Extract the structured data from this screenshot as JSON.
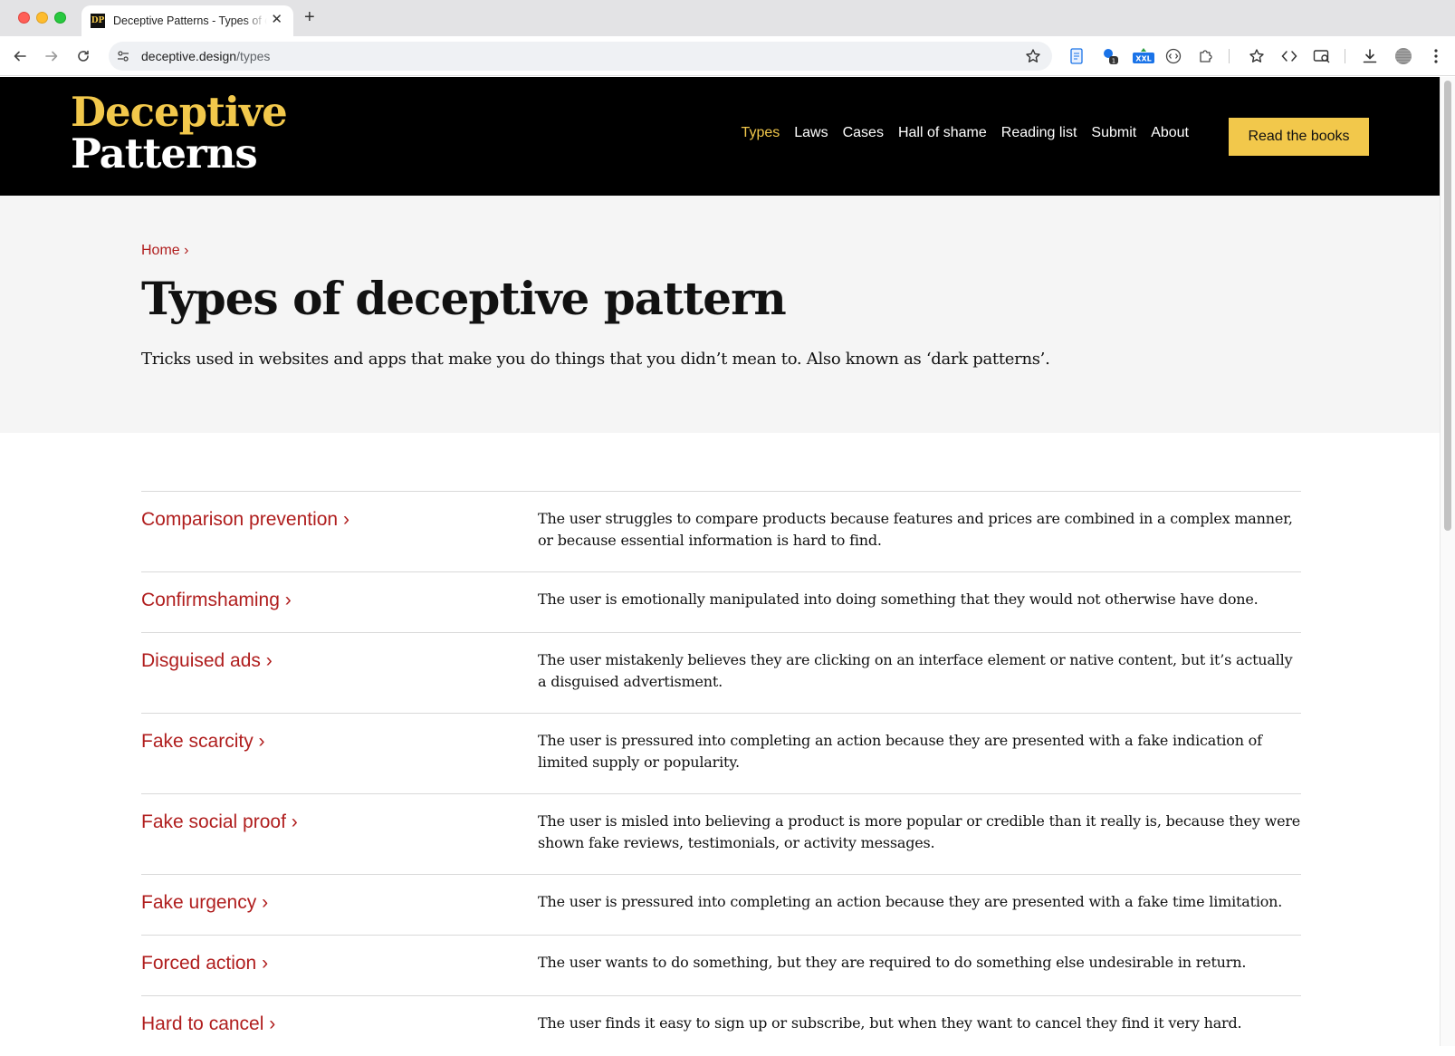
{
  "browser": {
    "tab_title": "Deceptive Patterns - Types of deceptive pattern",
    "favicon_text": "DP",
    "url_host": "deceptive.design",
    "url_path": "/types",
    "extension_badge_count": "1",
    "extension_badge_xxl": "XXL"
  },
  "site": {
    "logo_line1": "Deceptive",
    "logo_line2": "Patterns",
    "nav": [
      {
        "label": "Types",
        "active": true
      },
      {
        "label": "Laws"
      },
      {
        "label": "Cases"
      },
      {
        "label": "Hall of shame"
      },
      {
        "label": "Reading list"
      },
      {
        "label": "Submit"
      },
      {
        "label": "About"
      }
    ],
    "cta_label": "Read the books",
    "brand_yellow": "#f2c84b",
    "link_red": "#b01e1e"
  },
  "hero": {
    "breadcrumb": "Home ›",
    "title": "Types of deceptive pattern",
    "subtitle": "Tricks used in websites and apps that make you do things that you didn’t mean to. Also known as ‘dark patterns’."
  },
  "types": [
    {
      "name": "Comparison prevention ›",
      "description": "The user struggles to compare products because features and prices are combined in a complex manner, or because essential information is hard to find."
    },
    {
      "name": "Confirmshaming ›",
      "description": "The user is emotionally manipulated into doing something that they would not otherwise have done."
    },
    {
      "name": "Disguised ads ›",
      "description": "The user mistakenly believes they are clicking on an interface element or native content, but it’s actually a disguised advertisment."
    },
    {
      "name": "Fake scarcity ›",
      "description": "The user is pressured into completing an action because they are presented with a fake indication of limited supply or popularity."
    },
    {
      "name": "Fake social proof ›",
      "description": "The user is misled into believing a product is more popular or credible than it really is, because they were shown fake reviews, testimonials, or activity messages."
    },
    {
      "name": "Fake urgency ›",
      "description": "The user is pressured into completing an action because they are presented with a fake time limitation."
    },
    {
      "name": "Forced action ›",
      "description": "The user wants to do something, but they are required to do something else undesirable in return."
    },
    {
      "name": "Hard to cancel ›",
      "description": "The user finds it easy to sign up or subscribe, but when they want to cancel they find it very hard."
    }
  ]
}
